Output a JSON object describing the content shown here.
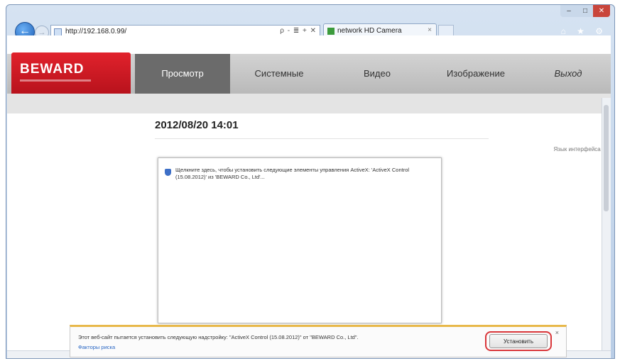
{
  "browser": {
    "url": "http://192.168.0.99/",
    "address_tools": "ρ - ≣ + ✕",
    "tab_title": "network HD Camera",
    "tab_close": "×",
    "toolbar_icons": "⌂ ★ ⚙",
    "window_controls": {
      "minimize": "–",
      "maximize": "□",
      "close": "✕"
    }
  },
  "page": {
    "logo": "BEWARD",
    "nav": [
      {
        "label": "Просмотр"
      },
      {
        "label": "Системные"
      },
      {
        "label": "Видео"
      },
      {
        "label": "Изображение"
      },
      {
        "label": "Выход"
      }
    ],
    "datetime": "2012/08/20 14:01",
    "language_link": "Язык интерфейса ▾",
    "plugin_message": "Щелкните здесь, чтобы установить следующие элементы управления ActiveX: 'ActiveX Control (15.08.2012)' из 'BEWARD Co., Ltd'..."
  },
  "notification": {
    "text": "Этот веб-сайт пытается установить следующую надстройку: \"ActiveX Control (15.08.2012)\" от \"BEWARD Co., Ltd\".",
    "link": "Факторы риска",
    "install_label": "Установить",
    "close": "×"
  },
  "colors": {
    "brand_red": "#d11a24",
    "nav_active": "#6b6b6b",
    "highlight_ring": "#d9363a"
  }
}
